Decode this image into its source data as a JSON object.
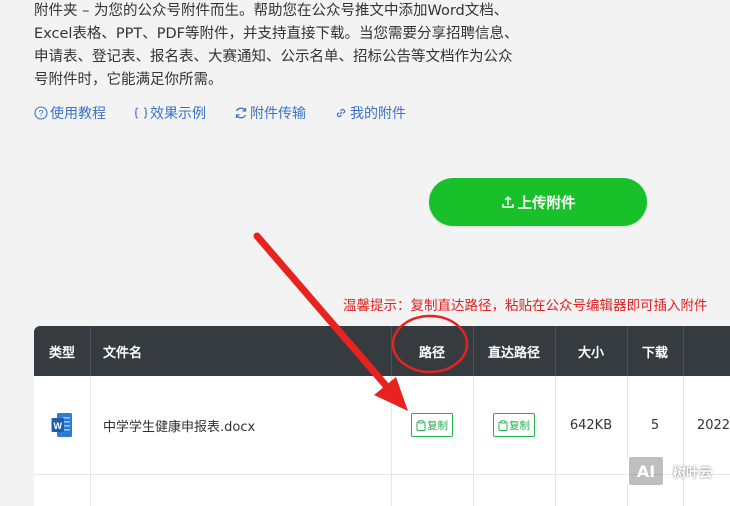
{
  "intro": {
    "lines": [
      "附件夹 – 为您的公众号附件而生。帮助您在公众号推文中添加Word文档、",
      "Excel表格、PPT、PDF等附件，并支持直接下载。当您需要分享招聘信息、",
      "申请表、登记表、报名表、大赛通知、公示名单、招标公告等文档作为公众",
      "号附件时，它能满足你所需。"
    ]
  },
  "links": [
    {
      "label": "使用教程",
      "icon": "question-circle-icon"
    },
    {
      "label": "效果示例",
      "icon": "brackets-icon"
    },
    {
      "label": "附件传输",
      "icon": "sync-icon"
    },
    {
      "label": "我的附件",
      "icon": "link-icon"
    }
  ],
  "upload": {
    "label": "上传附件",
    "icon": "upload-icon",
    "color": "#18c129"
  },
  "tip": "温馨提示：复制直达路径，粘贴在公众号编辑器即可插入附件",
  "table": {
    "headers": [
      "类型",
      "文件名",
      "路径",
      "直达路径",
      "大小",
      "下载",
      ""
    ],
    "rows": [
      {
        "type_icon": "word-doc-icon",
        "filename": "中学学生健康申报表.docx",
        "path_btn": "复制",
        "direct_btn": "复制",
        "size": "642KB",
        "downloads": "5",
        "date": "2022"
      }
    ]
  },
  "watermark": {
    "box": "AI",
    "text": "树叶云"
  },
  "colors": {
    "accent_green": "#18c129",
    "link_blue": "#3a74c9",
    "warning_red": "#e02020",
    "header_dark": "#363b40",
    "annotation_red": "#e8231f"
  }
}
